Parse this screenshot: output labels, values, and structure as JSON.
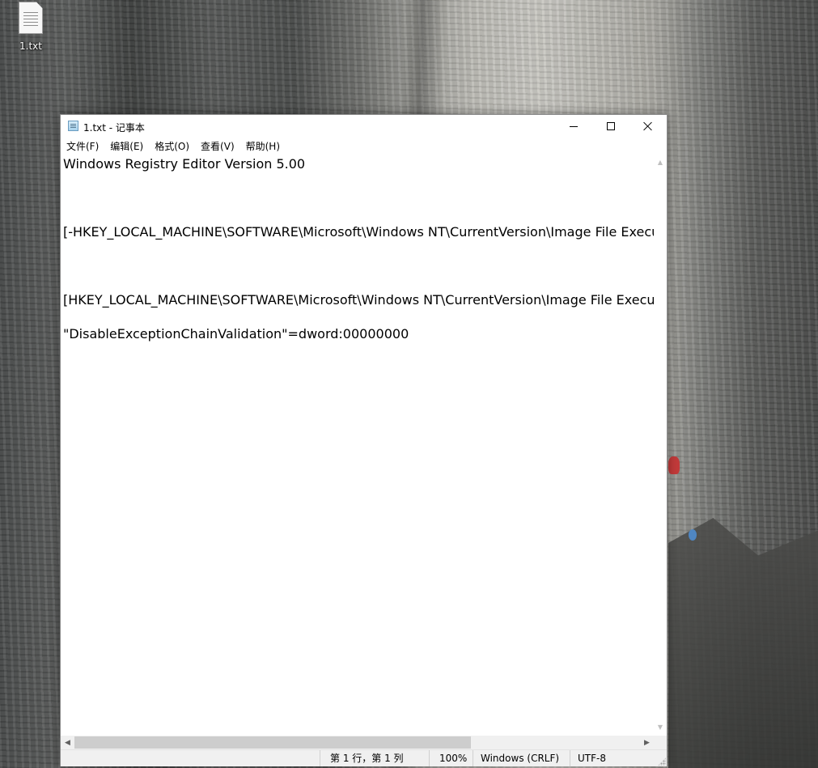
{
  "desktop": {
    "icon_label": "1.txt"
  },
  "window": {
    "title": "1.txt - 记事本",
    "menu": [
      {
        "label": "文件(F)"
      },
      {
        "label": "编辑(E)"
      },
      {
        "label": "格式(O)"
      },
      {
        "label": "查看(V)"
      },
      {
        "label": "帮助(H)"
      }
    ]
  },
  "editor": {
    "lines": [
      "Windows Registry Editor Version 5.00",
      "",
      "",
      "",
      "[-HKEY_LOCAL_MACHINE\\SOFTWARE\\Microsoft\\Windows NT\\CurrentVersion\\Image File Execu",
      "",
      "",
      "",
      "[HKEY_LOCAL_MACHINE\\SOFTWARE\\Microsoft\\Windows NT\\CurrentVersion\\Image File Execut",
      "",
      "\"DisableExceptionChainValidation\"=dword:00000000"
    ]
  },
  "statusbar": {
    "position": "第 1 行，第 1 列",
    "zoom": "100%",
    "line_ending": "Windows (CRLF)",
    "encoding": "UTF-8"
  },
  "colors": {
    "window_bg": "#ffffff",
    "statusbar_bg": "#f0f0f0",
    "scroll_thumb": "#cdcdcd"
  }
}
